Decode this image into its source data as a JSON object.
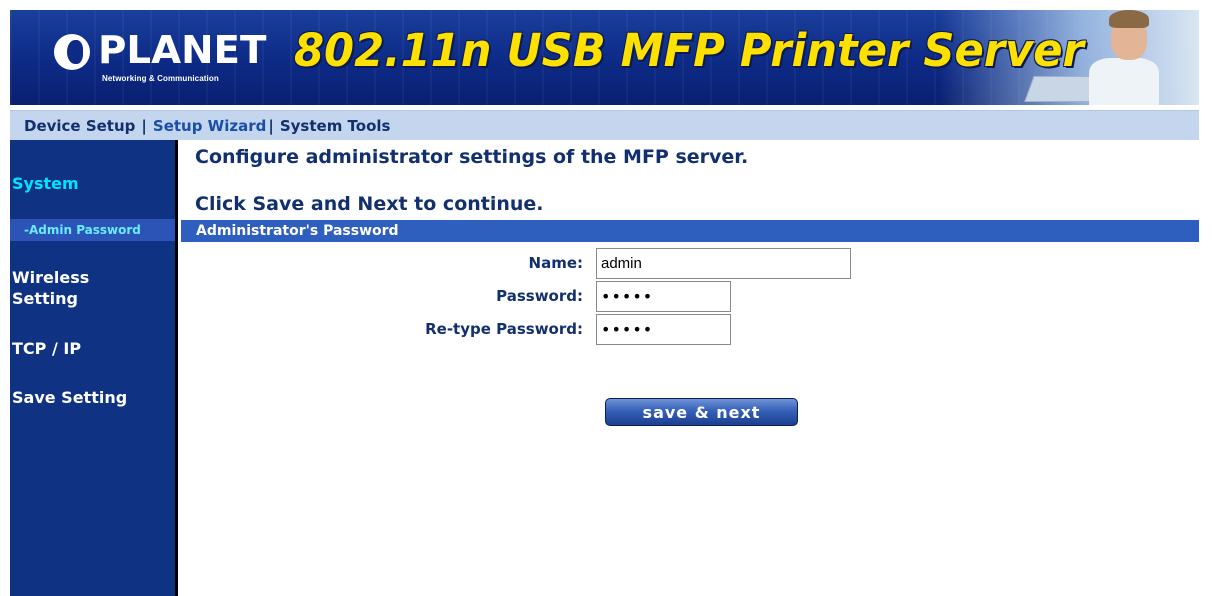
{
  "header": {
    "logo_text": "PLANET",
    "logo_tagline": "Networking & Communication",
    "product_title": "802.11n USB MFP Printer Server"
  },
  "topnav": {
    "items": [
      {
        "label": "Device Setup",
        "active": false
      },
      {
        "label": "Setup Wizard",
        "active": true
      },
      {
        "label": "System Tools",
        "active": false
      }
    ],
    "separator": "|"
  },
  "sidebar": {
    "items": [
      {
        "label": "System",
        "selected": true
      },
      {
        "label": "-Admin Password",
        "sub": true
      },
      {
        "label": "Wireless Setting"
      },
      {
        "label": "TCP / IP"
      },
      {
        "label": "Save Setting"
      }
    ]
  },
  "main": {
    "intro_line1": "Configure administrator settings of the MFP server.",
    "intro_line2": "Click Save and Next to continue.",
    "section_title": "Administrator's Password",
    "form": {
      "name_label": "Name:",
      "name_value": "admin",
      "password_label": "Password:",
      "password_value": "admin",
      "retype_label": "Re-type Password:",
      "retype_value": "admin"
    },
    "save_button": "save & next"
  },
  "colors": {
    "banner": "#0c2a86",
    "title_yellow": "#ffe100",
    "nav_bg": "#c4d5ee",
    "sidebar_bg": "#0f3382",
    "sidebar_selected": "#00e5ff",
    "section_bar": "#2f5fbe",
    "text_navy": "#13306e"
  }
}
